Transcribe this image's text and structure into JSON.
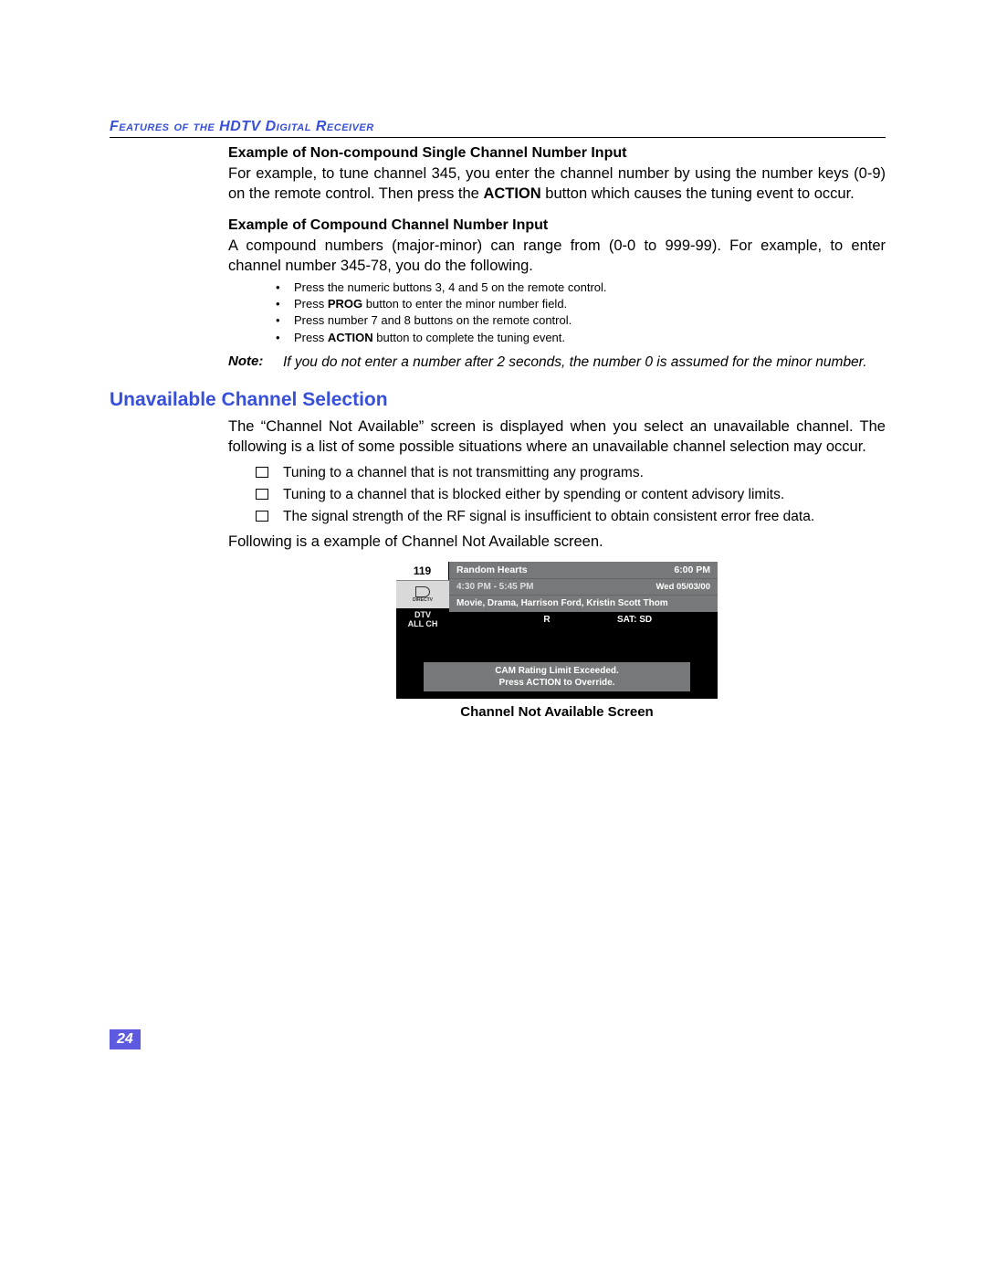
{
  "section_header": "Features of the HDTV Digital Receiver",
  "example1": {
    "heading": "Example of Non-compound Single Channel Number Input",
    "text_before_action": "For example, to tune channel 345, you enter the channel number by using the number keys (0-9) on the remote control. Then press the ",
    "action_word": "ACTION",
    "text_after_action": " button which causes the tuning event to occur."
  },
  "example2": {
    "heading": "Example of Compound Channel Number Input",
    "intro": "A compound numbers (major-minor) can range from (0-0 to 999-99). For example, to enter channel number 345-78, you do the following.",
    "bullets": [
      {
        "pre": "Press the numeric buttons 3, 4 and 5 on the remote control.",
        "bold": "",
        "post": ""
      },
      {
        "pre": "Press ",
        "bold": "PROG",
        "post": " button to enter the minor number field."
      },
      {
        "pre": "Press number 7 and 8 buttons on the remote control.",
        "bold": "",
        "post": ""
      },
      {
        "pre": "Press ",
        "bold": "ACTION",
        "post": " button to complete the tuning event."
      }
    ],
    "note_label": "Note:",
    "note_text": "If you do not enter a number after 2 seconds, the number 0 is assumed for the minor number."
  },
  "unavailable": {
    "heading": "Unavailable Channel Selection",
    "intro": "The “Channel Not Available” screen is displayed when you select an unavailable channel. The following is a list of some possible situations where an unavailable channel selection may occur.",
    "checks": [
      "Tuning to a channel that is not transmitting any programs.",
      "Tuning to a channel that is blocked either by spending or content advisory limits.",
      "The signal strength of the RF signal is insufficient to obtain consistent error free data."
    ],
    "followup": "Following is a example of Channel Not Available screen."
  },
  "screen": {
    "channel": "119",
    "logo": "DIRECTV",
    "dtv": "DTV",
    "allch": "ALL CH",
    "title": "Random Hearts",
    "clock": "6:00 PM",
    "range": "4:30 PM - 5:45 PM",
    "date": "Wed 05/03/00",
    "desc": "Movie, Drama, Harrison Ford, Kristin Scott Thom",
    "rating": "R",
    "sat": "SAT: SD",
    "msg1": "CAM Rating Limit Exceeded.",
    "msg2": "Press ACTION to Override."
  },
  "caption": "Channel Not Available Screen",
  "page_number": "24"
}
